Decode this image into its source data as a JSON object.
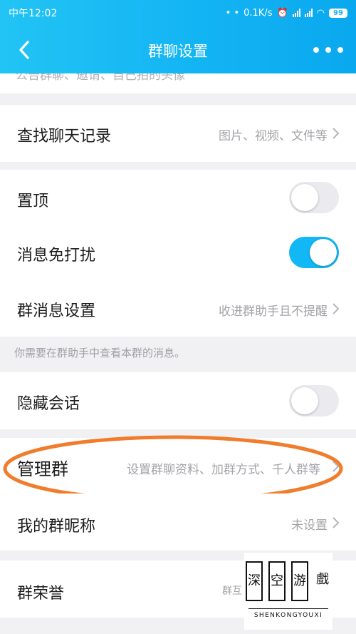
{
  "status_bar": {
    "time": "中午12:02",
    "net_speed": "0.1K/s",
    "battery": "99"
  },
  "header": {
    "title": "群聊设置"
  },
  "top_partial_text": "公告群聊、邀请、自己拍的头像",
  "search_history": {
    "label": "查找聊天记录",
    "value": "图片、视频、文件等"
  },
  "pin_top": {
    "label": "置顶",
    "toggle": "off"
  },
  "mute": {
    "label": "消息免打扰",
    "toggle": "on"
  },
  "group_msg_settings": {
    "label": "群消息设置",
    "value": "收进群助手且不提醒"
  },
  "group_msg_hint": "你需要在群助手中查看本群的消息。",
  "hide_session": {
    "label": "隐藏会话",
    "toggle": "off"
  },
  "manage_group": {
    "label": "管理群",
    "value": "设置群聊资料、加群方式、千人群等"
  },
  "my_nickname": {
    "label": "我的群昵称",
    "value": "未设置"
  },
  "group_honor": {
    "label": "群荣誉",
    "value": "群互"
  },
  "watermark": {
    "chars": [
      "深",
      "空",
      "游",
      "戲"
    ],
    "pinyin": "SHENKONGYOUXI"
  },
  "colors": {
    "header": "#12b3f3",
    "toggle_on": "#12b7f5",
    "highlight": "#f07c2c"
  }
}
